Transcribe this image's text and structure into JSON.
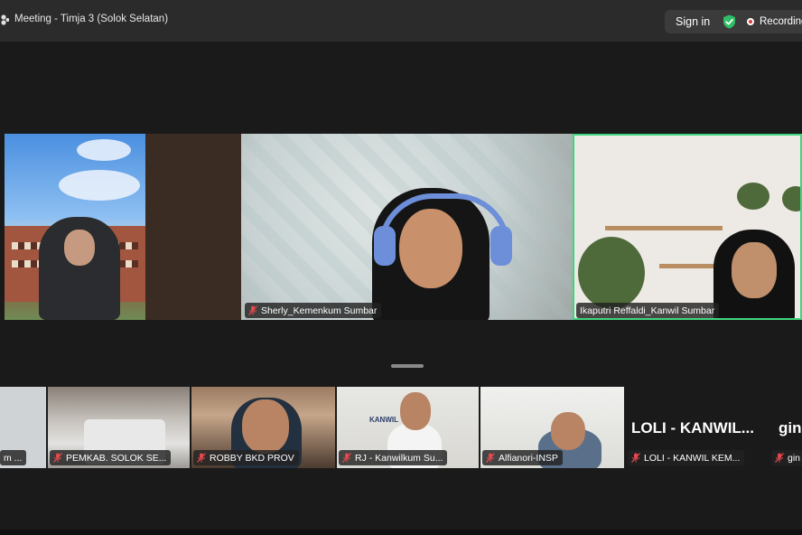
{
  "window": {
    "title": "Meeting - Timja 3 (Solok Selatan)",
    "sign_in_label": "Sign in",
    "recording_label": "Recording",
    "accent_color": "#3ed67f",
    "recording_color": "#e03a3a"
  },
  "main_grid": {
    "participants": [
      {
        "name": ""
      },
      {
        "name": ""
      },
      {
        "name": "Sherly_Kemenkum Sumbar",
        "muted": true
      },
      {
        "name": "Ikaputri Reffaldi_Kanwil Sumbar",
        "muted": false,
        "active_speaker": true
      }
    ]
  },
  "strip": {
    "participants": [
      {
        "name": "m ..."
      },
      {
        "name": "PEMKAB. SOLOK SE..."
      },
      {
        "name": "ROBBY BKD PROV"
      },
      {
        "name": "RJ - Kanwilkum Su..."
      },
      {
        "name": "Alfianori-INSP"
      },
      {
        "name": "LOLI - KANWIL KEM...",
        "display_name": "LOLI - KANWIL..."
      },
      {
        "name": "gin",
        "display_name": "gin"
      }
    ],
    "sign_text": "KANWIL"
  },
  "icons": {
    "title": "zoom-people-icon",
    "shield": "shield-check-icon",
    "mic_off": "mic-off-icon",
    "recording": "record-dot-icon"
  }
}
